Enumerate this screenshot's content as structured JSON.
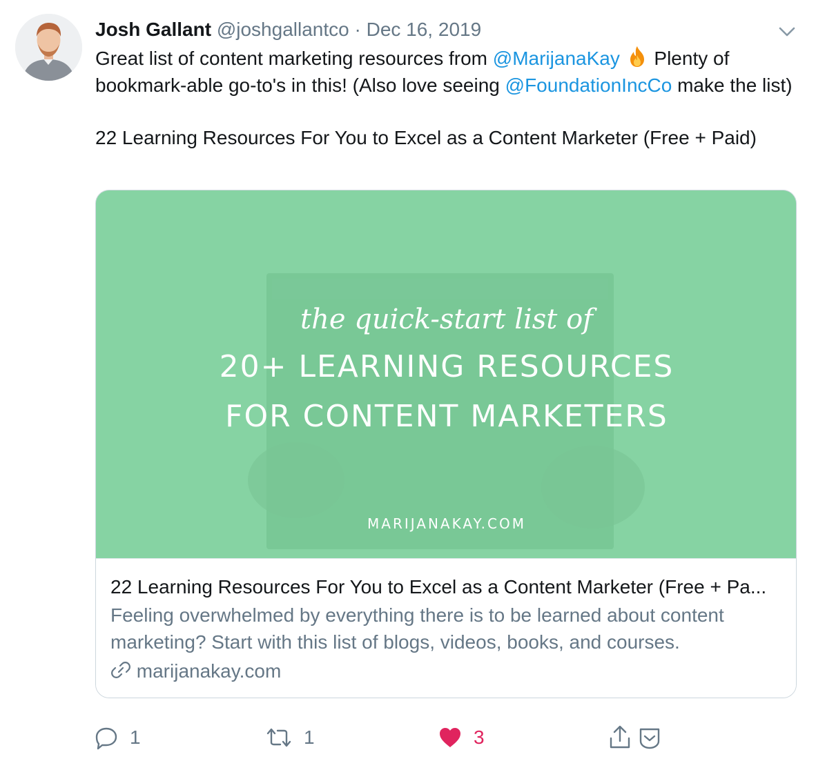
{
  "tweet": {
    "author_name": "Josh Gallant",
    "author_handle": "@joshgallantco",
    "separator": "·",
    "date": "Dec 16, 2019",
    "text_part1": "Great list of content marketing resources from ",
    "mention1": "@MarijanaKay",
    "emoji": "fire-emoji",
    "text_part2": " Plenty of bookmark-able go-to's in this! (Also love seeing ",
    "mention2": "@FoundationIncCo",
    "text_part3": " make the list)",
    "link_text": "22 Learning Resources For You to Excel as a Content Marketer (Free + Paid)"
  },
  "card": {
    "image_line1": "the quick-start list of",
    "image_line2": "20+ LEARNING RESOURCES",
    "image_line3": "FOR CONTENT MARKETERS",
    "image_footer": "MARIJANAKAY.COM",
    "title": "22 Learning Resources For You to Excel as a Content Marketer (Free + Pa...",
    "description": "Feeling overwhelmed by everything there is to be learned about content marketing? Start with this list of blogs, videos, books, and courses.",
    "domain": "marijanakay.com",
    "image_color": "#86d3a3"
  },
  "actions": {
    "reply_count": "1",
    "retweet_count": "1",
    "like_count": "3",
    "like_color": "#e0245e",
    "icons": [
      "reply-icon",
      "retweet-icon",
      "like-icon",
      "share-icon",
      "save-icon"
    ]
  },
  "colors": {
    "link": "#1b95e0",
    "muted": "#657786",
    "border": "#ccd6dd"
  }
}
